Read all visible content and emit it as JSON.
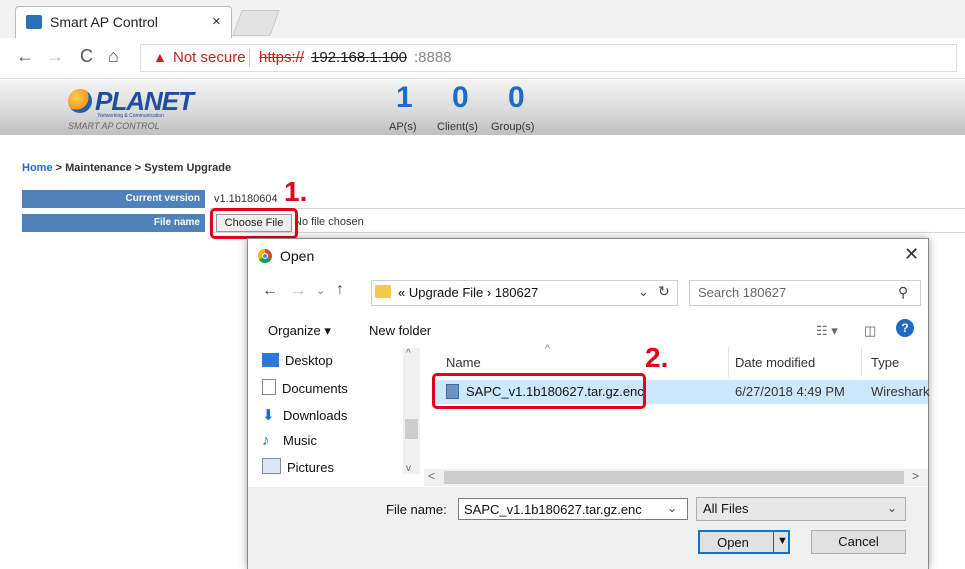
{
  "browser": {
    "tab_title": "Smart AP Control",
    "tab_close": "×",
    "not_secure": "Not secure",
    "url_scheme": "https://",
    "url_host": "192.168.1.100",
    "url_port": ":8888",
    "nav": {
      "back": "←",
      "forward": "→",
      "reload": "C",
      "home": "⌂"
    }
  },
  "header": {
    "logo": "PLANET",
    "logo_sub": "Networking & Communication",
    "logo_tag": "SMART AP CONTROL",
    "stats": [
      {
        "value": "1",
        "label": "AP(s)"
      },
      {
        "value": "0",
        "label": "Client(s)"
      },
      {
        "value": "0",
        "label": "Group(s)"
      }
    ]
  },
  "breadcrumb": {
    "home": "Home",
    "path": " > Maintenance > System Upgrade"
  },
  "form": {
    "current_version_label": "Current version",
    "current_version": "v1.1b180604",
    "file_name_label": "File name",
    "choose_file": "Choose File",
    "no_file": "No file chosen"
  },
  "annotations": {
    "step1": "1.",
    "step2": "2."
  },
  "dialog": {
    "title": "Open",
    "close": "✕",
    "address": "« Upgrade File › 180627",
    "search_placeholder": "Search 180627",
    "organize": "Organize ▾",
    "new_folder": "New folder",
    "help": "?",
    "nav_items": [
      "Desktop",
      "Documents",
      "Downloads",
      "Music",
      "Pictures"
    ],
    "columns": {
      "name": "Name",
      "date": "Date modified",
      "type": "Type"
    },
    "file": {
      "name": "SAPC_v1.1b180627.tar.gz.enc",
      "date": "6/27/2018 4:49 PM",
      "type": "Wireshark"
    },
    "file_name_label": "File name:",
    "file_name_value": "SAPC_v1.1b180627.tar.gz.enc",
    "file_type": "All Files",
    "open_button": "Open",
    "cancel_button": "Cancel"
  },
  "colors": {
    "accent": "#4f81bd",
    "annotation": "#e3001b",
    "link": "#1f6cc4"
  }
}
